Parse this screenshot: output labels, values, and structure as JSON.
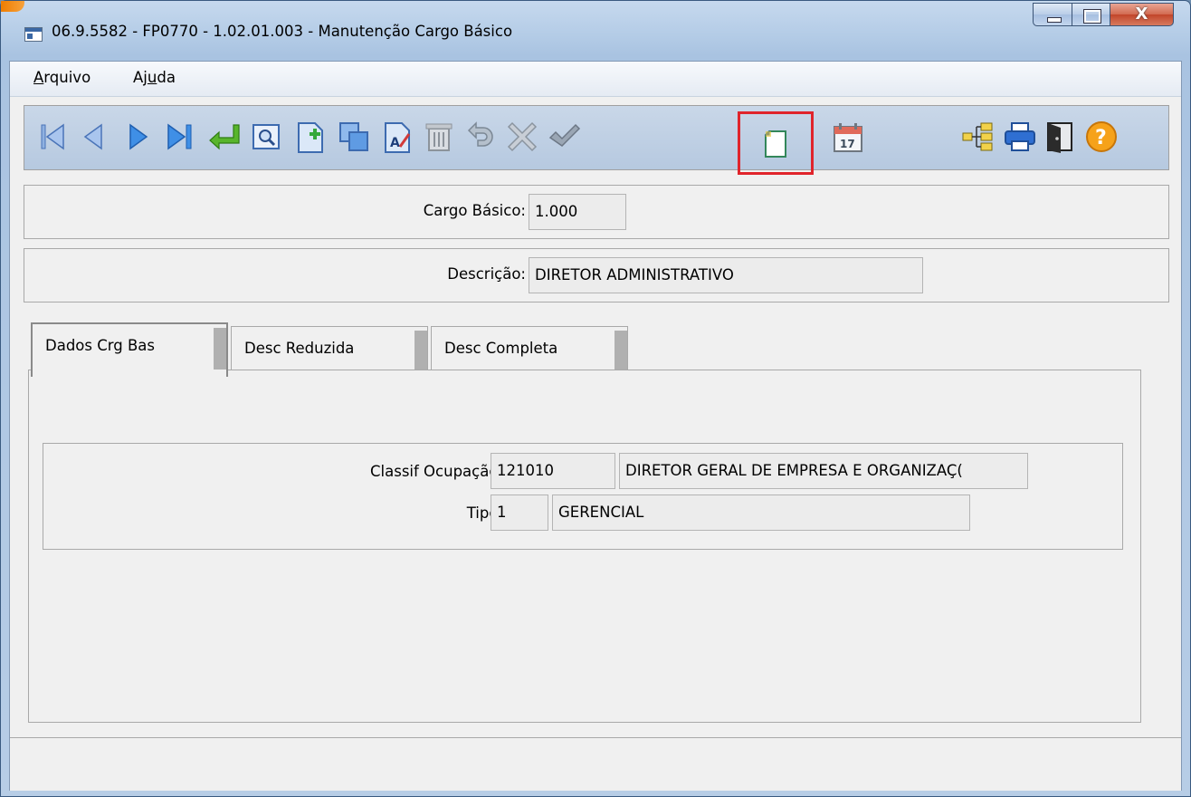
{
  "window": {
    "title": "06.9.5582 - FP0770 - 1.02.01.003 - Manutenção Cargo Básico",
    "close_glyph": "X"
  },
  "menu": {
    "items": [
      {
        "accel": "A",
        "rest": "rquivo"
      },
      {
        "pre": "Aj",
        "accel": "u",
        "post": "da"
      }
    ]
  },
  "toolbar": {
    "buttons": [
      "first-record-icon",
      "previous-record-icon",
      "next-record-icon",
      "last-record-icon",
      "goto-icon",
      "search-icon",
      "new-record-icon",
      "copy-icon",
      "edit-icon",
      "delete-icon",
      "undo-icon",
      "cancel-icon",
      "confirm-icon",
      "blank-document-icon",
      "calendar-icon",
      "hierarchy-icon",
      "print-icon",
      "exit-icon",
      "help-icon"
    ],
    "calendar_day": "17",
    "help_glyph": "?"
  },
  "form": {
    "cargo_basico_label": "Cargo Básico:",
    "cargo_basico_value": "1.000",
    "descricao_label": "Descrição:",
    "descricao_value": "DIRETOR ADMINISTRATIVO"
  },
  "tabs": [
    {
      "label": "Dados Crg Bas"
    },
    {
      "label": "Desc Reduzida"
    },
    {
      "label": "Desc Completa"
    }
  ],
  "dados_tab": {
    "classif_label": "Classif Ocupação:",
    "classif_code": "121010",
    "classif_desc": "DIRETOR GERAL DE EMPRESA E ORGANIZAÇ(",
    "tipo_label": "Tipo:",
    "tipo_code": "1",
    "tipo_desc": "GERENCIAL"
  },
  "colors": {
    "highlight": "#e0242b"
  }
}
